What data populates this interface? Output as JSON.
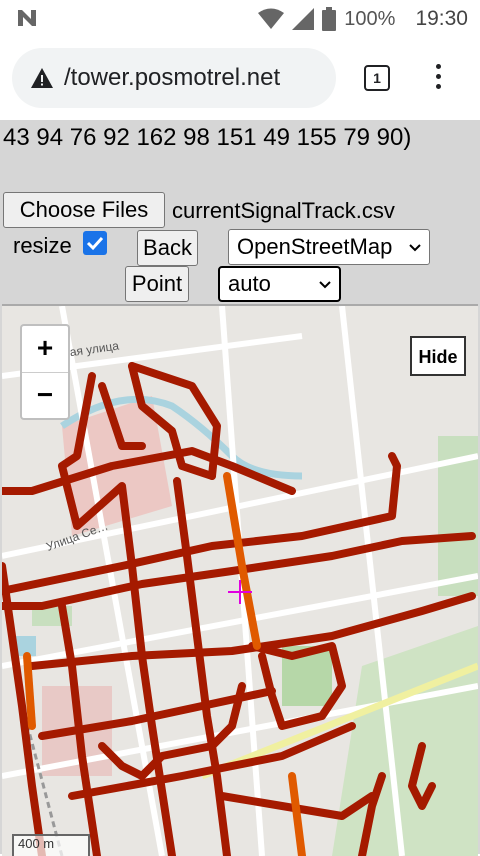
{
  "status": {
    "battery": "100%",
    "time": "19:30"
  },
  "browser": {
    "url": "/tower.posmotrel.net",
    "tab_count": "1"
  },
  "page": {
    "data_text": "43 94 76 92 162 98 151 49 155 79 90)",
    "choose_files_label": "Choose Files",
    "filename": "currentSignalTrack.csv",
    "resize_label": "resize",
    "back_label": "Back",
    "map_source": "OpenStreetMap",
    "point_label": "Point",
    "mode": "auto"
  },
  "map": {
    "zoom_in": "+",
    "zoom_out": "−",
    "hide_label": "Hide",
    "street1": "…жная улица",
    "street2": "Улица Се…",
    "scale_label": "400 m"
  },
  "colors": {
    "track_dark": "#a51a00",
    "track_orange": "#e05a00",
    "crosshair": "#e000e0",
    "park": "#c8dfbf"
  }
}
